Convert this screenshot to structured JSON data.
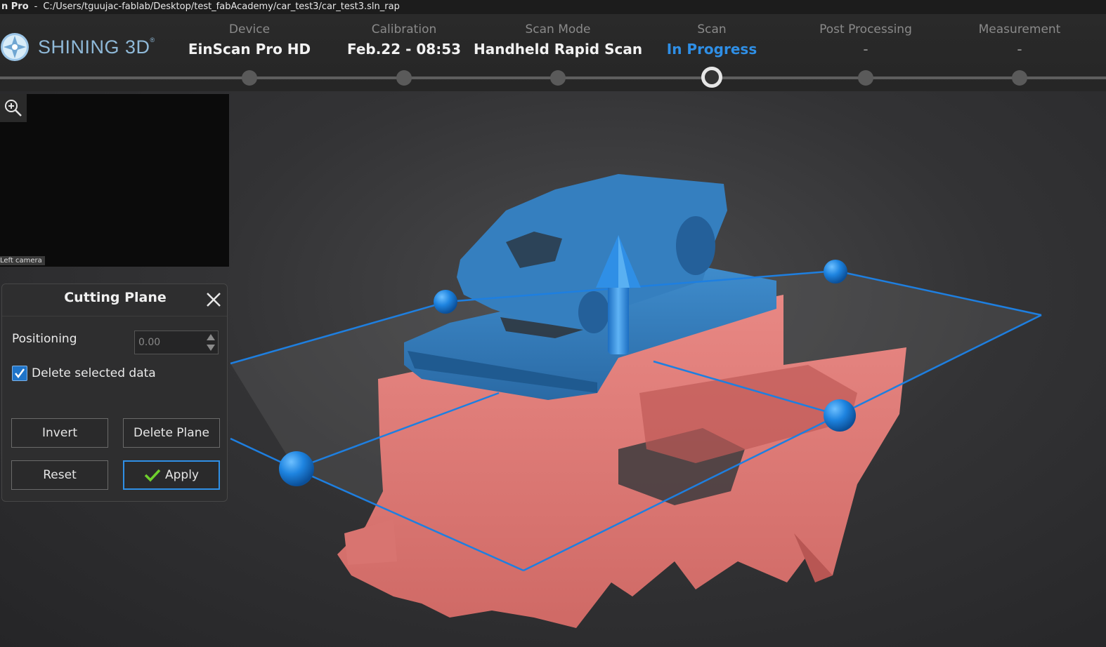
{
  "titlebar": {
    "app_name": "n Pro",
    "separator": "-",
    "path": "C:/Users/tguujac-fablab/Desktop/test_fabAcademy/car_test3/car_test3.sln_rap"
  },
  "brand": {
    "name": "SHINING 3D",
    "mark": "®"
  },
  "steps": [
    {
      "label": "Device",
      "value": "EinScan Pro HD"
    },
    {
      "label": "Calibration",
      "value": "Feb.22 - 08:53"
    },
    {
      "label": "Scan Mode",
      "value": "Handheld Rapid Scan"
    },
    {
      "label": "Scan",
      "value": "In Progress"
    },
    {
      "label": "Post Processing",
      "value": "-"
    },
    {
      "label": "Measurement",
      "value": "-"
    }
  ],
  "camera": {
    "label": "Left camera",
    "zoom_icon": "zoom-in-icon"
  },
  "cutting_plane": {
    "title": "Cutting Plane",
    "positioning_label": "Positioning",
    "positioning_value": "0.00",
    "delete_selected_label": "Delete selected data",
    "delete_selected_checked": true,
    "invert_label": "Invert",
    "delete_plane_label": "Delete Plane",
    "reset_label": "Reset",
    "apply_label": "Apply"
  },
  "colors": {
    "accent": "#2f8fe6",
    "scan_blue": "#2f78b8",
    "selection_red": "#e07672",
    "plane_line": "#1e7fe0"
  }
}
